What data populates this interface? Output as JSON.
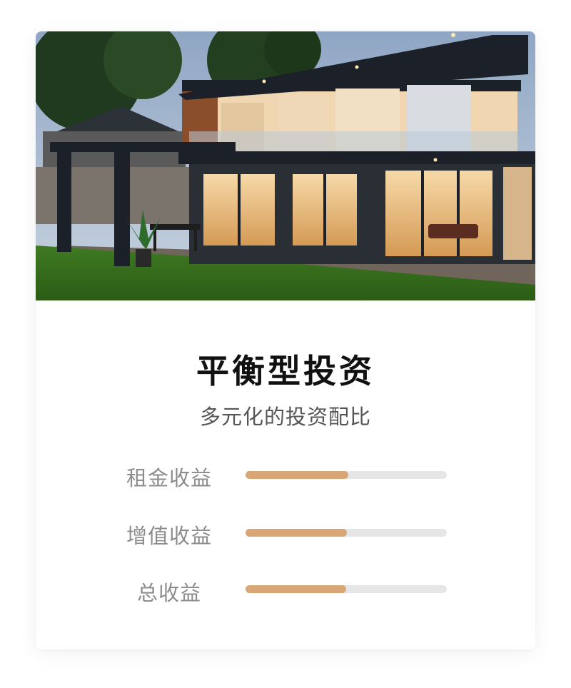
{
  "card": {
    "title": "平衡型投资",
    "subtitle": "多元化的投资配比"
  },
  "colors": {
    "accent": "#d9a676",
    "track": "#e6e6e6",
    "title": "#111111",
    "subtitle": "#555555",
    "label": "#8c8c8c"
  },
  "metrics": [
    {
      "label": "租金收益",
      "value": 0.51
    },
    {
      "label": "增值收益",
      "value": 0.505
    },
    {
      "label": "总收益",
      "value": 0.5
    }
  ]
}
